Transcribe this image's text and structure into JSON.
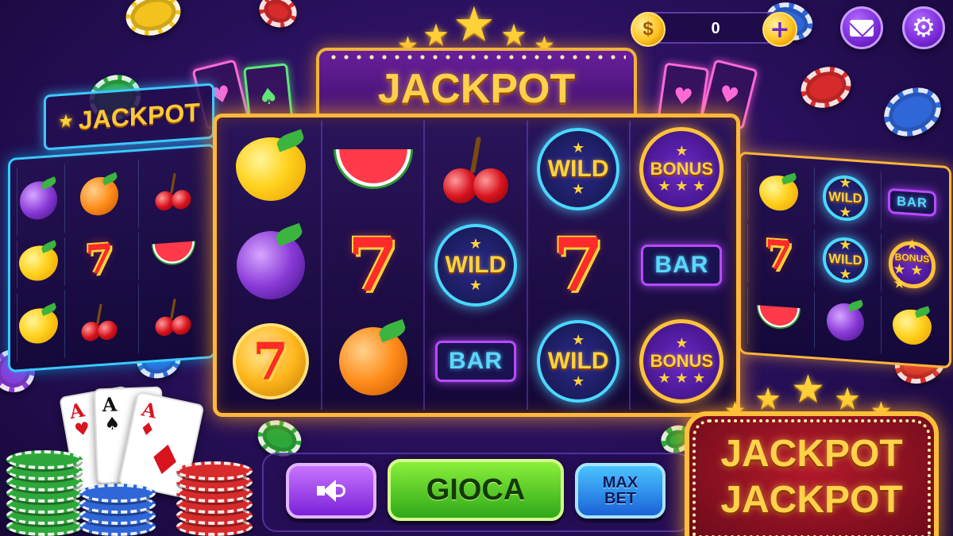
{
  "hud": {
    "coin_symbol": "$",
    "coin_balance": "0",
    "add_symbol": "+"
  },
  "top_banner": {
    "title": "JACKPOT"
  },
  "side_left_banner": {
    "title": "JACKPOT"
  },
  "reels": [
    [
      "lemon",
      "plum",
      "seven-coin"
    ],
    [
      "watermelon",
      "seven",
      "orange"
    ],
    [
      "cherry",
      "wild",
      "bar"
    ],
    [
      "wild",
      "seven",
      "wild"
    ],
    [
      "bonus",
      "bar",
      "bonus"
    ]
  ],
  "symbols": {
    "wild_label": "WILD",
    "bonus_label": "BONUS",
    "bar_label": "BAR",
    "seven_label": "7"
  },
  "side_left_reels": [
    [
      "plum",
      "lemon",
      "lemon"
    ],
    [
      "orange",
      "seven",
      "cherry"
    ],
    [
      "cherry",
      "watermelon",
      "cherry"
    ]
  ],
  "side_right_reels": [
    [
      "lemon",
      "seven",
      "watermelon"
    ],
    [
      "wild",
      "wild",
      "plum"
    ],
    [
      "bar",
      "bonus",
      "lemon"
    ]
  ],
  "controls": {
    "spin_label": "GIOCA",
    "max_bet_line1": "MAX",
    "max_bet_line2": "BET"
  },
  "jackpot_sign": {
    "line1": "JACKPOT",
    "line2": "JACKPOT"
  },
  "cards": [
    {
      "rank": "A",
      "suit": "♥",
      "color": "red"
    },
    {
      "rank": "A",
      "suit": "♠",
      "color": "black"
    },
    {
      "rank": "A",
      "suit": "♦",
      "color": "red"
    }
  ],
  "icons": {
    "speaker": "speaker-icon",
    "mail": "mail-icon",
    "settings": "gear-icon",
    "coin": "coin-icon",
    "star": "star-icon"
  },
  "colors": {
    "background": "#2b1160",
    "reel_frame": "#ffb83a",
    "spin_button": "#3fc22a",
    "max_bet_button": "#2a7ae8",
    "sound_button": "#9a3ae8",
    "gold_text": "#ffd24a",
    "neon_cyan": "#3cc9ff"
  }
}
